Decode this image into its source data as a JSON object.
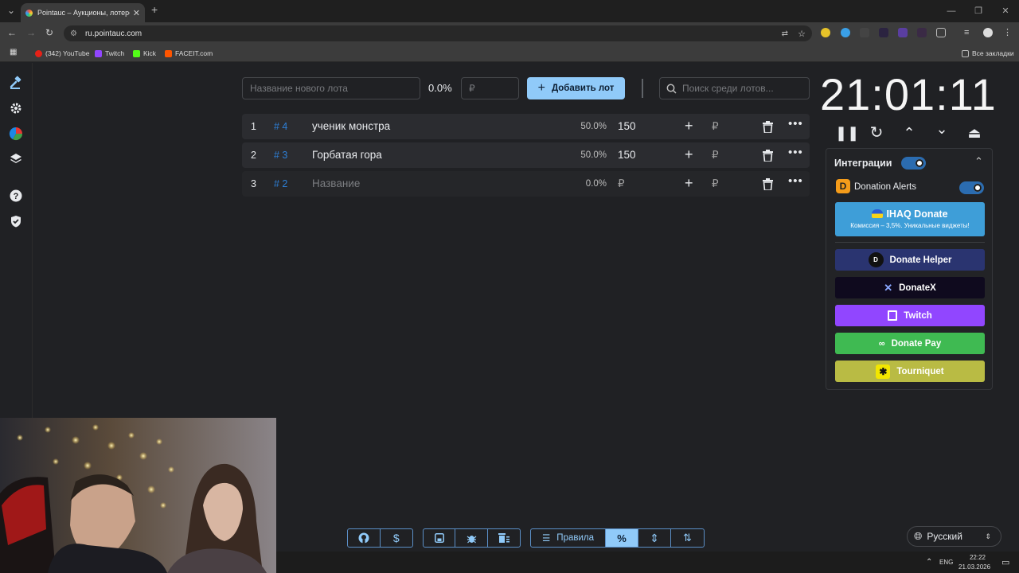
{
  "browser": {
    "tab_title": "Pointauc – Аукционы, лотереи",
    "url": "ru.pointauc.com",
    "bookmarks": [
      {
        "label": "(342) YouTube",
        "color": "#e62117"
      },
      {
        "label": "Twitch",
        "color": "#9146ff"
      },
      {
        "label": "Kick",
        "color": "#53fc18"
      },
      {
        "label": "FACEIT.com",
        "color": "#ff5500"
      }
    ],
    "all_bookmarks": "Все закладки"
  },
  "lot_form": {
    "name_placeholder": "Название нового лота",
    "percent": "0.0%",
    "amount_placeholder": "₽",
    "add_label": "Добавить лот",
    "search_placeholder": "Поиск среди лотов..."
  },
  "lots": [
    {
      "index": "1",
      "id": "# 4",
      "name": "ученик монстра",
      "percent": "50.0%",
      "amount": "150",
      "placeholder": false
    },
    {
      "index": "2",
      "id": "# 3",
      "name": "Горбатая гора",
      "percent": "50.0%",
      "amount": "150",
      "placeholder": false
    },
    {
      "index": "3",
      "id": "# 2",
      "name": "Название",
      "percent": "0.0%",
      "amount": "₽",
      "placeholder": true
    }
  ],
  "currency_symbol": "₽",
  "timer": "21:01:11",
  "integrations": {
    "title": "Интеграции",
    "donation_alerts": "Donation Alerts",
    "ihaq": {
      "label": "IHAQ Donate",
      "sub": "Комиссия – 3,5%. Уникальные виджеты!",
      "color": "#3e9ed8"
    },
    "buttons": [
      {
        "label": "Donate Helper",
        "color": "#2a3470"
      },
      {
        "label": "DonateX",
        "color": "#0f0a1e"
      },
      {
        "label": "Twitch",
        "color": "#9146ff"
      },
      {
        "label": "Donate Pay",
        "color": "#3fba52"
      },
      {
        "label": "Tourniquet",
        "color": "#b9bb44"
      }
    ]
  },
  "bottom_toolbar": {
    "rules_label": "Правила"
  },
  "language": "Русский",
  "taskbar": {
    "lang": "ENG",
    "time": "22:22",
    "date": "21.03.2026"
  },
  "colors": {
    "accent": "#90caf9",
    "background": "#202124",
    "row": "#2b2c30"
  }
}
